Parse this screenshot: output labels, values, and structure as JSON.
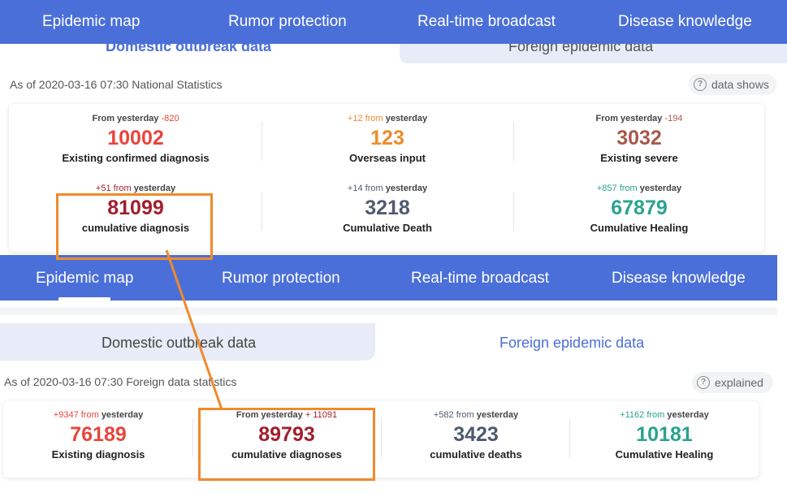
{
  "nav_tabs": [
    "Epidemic map",
    "Rumor protection",
    "Real-time broadcast",
    "Disease knowledge"
  ],
  "top": {
    "sub_tabs": [
      "Domestic outbreak data",
      "Foreign epidemic data"
    ],
    "stats_line": "As of 2020-03-16 07:30 National Statistics",
    "info_pill": "data shows",
    "cells": [
      {
        "delta_pre": "From yesterday",
        "delta_val": "-820",
        "delta_post": "",
        "value": "10002",
        "label": "Existing confirmed diagnosis",
        "color": "#e8453c",
        "delta_color": "#e8453c"
      },
      {
        "delta_pre": "",
        "delta_val": "+12 from",
        "delta_post": "yesterday",
        "value": "123",
        "label": "Overseas input",
        "color": "#f08a2c",
        "delta_color": "#f08a2c"
      },
      {
        "delta_pre": "From yesterday",
        "delta_val": "-194",
        "delta_post": "",
        "value": "3032",
        "label": "Existing severe",
        "color": "#a8584c",
        "delta_color": "#a8584c"
      },
      {
        "delta_pre": "",
        "delta_val": "+51 from",
        "delta_post": "yesterday",
        "value": "81099",
        "label": "cumulative diagnosis",
        "color": "#a21e2e",
        "delta_color": "#a21e2e"
      },
      {
        "delta_pre": "",
        "delta_val": "+14 from",
        "delta_post": "yesterday",
        "value": "3218",
        "label": "Cumulative Death",
        "color": "#4e5a70",
        "delta_color": "#4e5a70"
      },
      {
        "delta_pre": "",
        "delta_val": "+857 from",
        "delta_post": "yesterday",
        "value": "67879",
        "label": "Cumulative Healing",
        "color": "#2aa38e",
        "delta_color": "#2aa38e"
      }
    ]
  },
  "bottom": {
    "sub_tabs": [
      "Domestic outbreak data",
      "Foreign epidemic data"
    ],
    "stats_line": "As of 2020-03-16 07:30 Foreign data statistics",
    "info_pill": "explained",
    "cells": [
      {
        "delta_pre": "",
        "delta_val": "+9347 from",
        "delta_post": "yesterday",
        "value": "76189",
        "label": "Existing diagnosis",
        "color": "#e8453c",
        "delta_color": "#e8453c"
      },
      {
        "delta_pre": "From yesterday",
        "delta_val": "+ 11091",
        "delta_post": "",
        "value": "89793",
        "label": "cumulative diagnoses",
        "color": "#a21e2e",
        "delta_color": "#a21e2e"
      },
      {
        "delta_pre": "",
        "delta_val": "+582 from",
        "delta_post": "yesterday",
        "value": "3423",
        "label": "cumulative deaths",
        "color": "#4e5a70",
        "delta_color": "#4e5a70"
      },
      {
        "delta_pre": "",
        "delta_val": "+1162 from",
        "delta_post": "yesterday",
        "value": "10181",
        "label": "Cumulative Healing",
        "color": "#2aa38e",
        "delta_color": "#2aa38e"
      }
    ]
  },
  "colors": {
    "nav_bg": "#4a6fd8",
    "active_tab": "#4a6fd8",
    "highlight": "#f08a2c"
  }
}
